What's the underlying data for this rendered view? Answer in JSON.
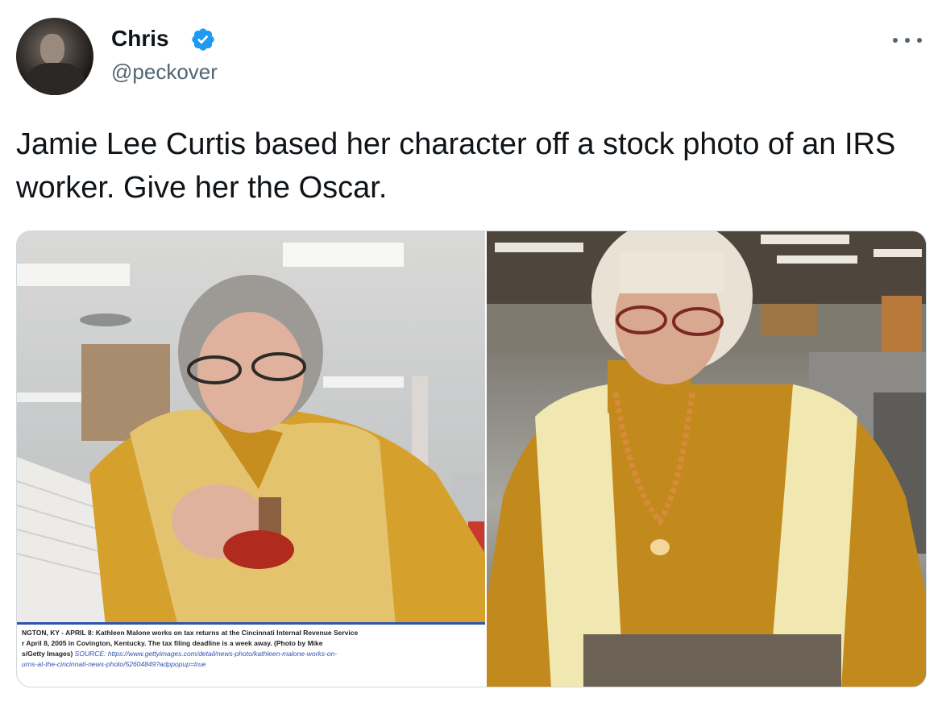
{
  "author": {
    "display_name": "Chris",
    "handle": "@peckover",
    "verified": true,
    "verified_color": "#1d9bf0"
  },
  "tweet": {
    "text": "Jamie Lee Curtis based her character off a stock photo of an IRS worker. Give her the Oscar."
  },
  "media": {
    "left_caption": {
      "line1": "NGTON, KY - APRIL 8: Kathleen Malone works on tax returns at the Cincinnati Internal Revenue Service",
      "line2": "r April 8, 2005 in Covington, Kentucky. The tax filing deadline is a week away. (Photo by Mike",
      "line3_a": "s/Getty Images) ",
      "line3_source": "SOURCE: https://www.gettyimages.com/detail/news-photo/kathleen-malone-works-on-",
      "line4": "urns-at-the-cincinnati-news-photo/52604849?adppopup=true"
    }
  },
  "icons": {
    "more": "more-horizontal-icon",
    "verified": "verified-badge-icon"
  }
}
